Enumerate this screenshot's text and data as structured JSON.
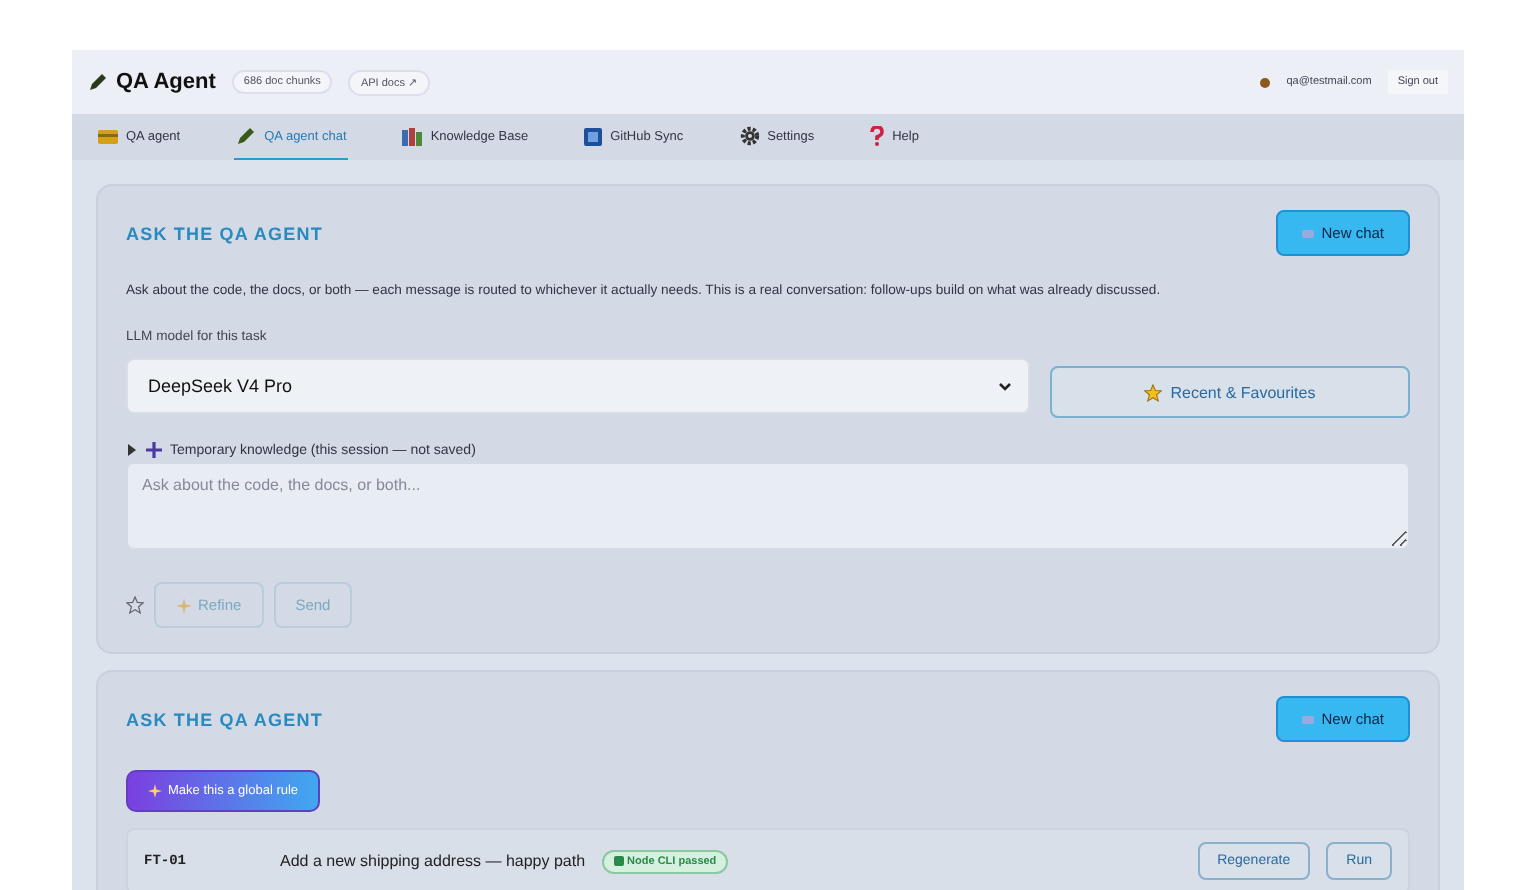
{
  "header": {
    "title": "QA Agent",
    "badges": [
      "686 doc chunks",
      "API docs ↗"
    ],
    "user": "qa@testmail.com",
    "sign_out": "Sign out"
  },
  "tabs": [
    {
      "label": "QA agent",
      "selected": false
    },
    {
      "label": "QA agent chat",
      "selected": true
    },
    {
      "label": "Knowledge Base",
      "selected": false
    },
    {
      "label": "GitHub Sync",
      "selected": false
    },
    {
      "label": "Settings",
      "selected": false
    },
    {
      "label": "Help",
      "selected": false
    }
  ],
  "chat_panel": {
    "title": "ASK THE QA AGENT",
    "new_chat": "New chat",
    "description": "Ask about the code, the docs, or both — each message is routed to whichever it actually needs. This is a real conversation: follow-ups build on what was already discussed.",
    "model_label": "LLM model for this task",
    "model": "DeepSeek V4 Pro",
    "recent": "Recent & Favourites",
    "temp_knowledge": {
      "label": "Temporary knowledge (this session — not saved)",
      "expanded": false
    },
    "placeholder": "Ask about the code, the docs, or both...",
    "favourite": false,
    "refine": {
      "label": "Refine",
      "disabled": true
    },
    "send": {
      "label": "Send",
      "disabled": true
    }
  },
  "second_panel": {
    "title": "ASK THE QA AGENT",
    "new_chat": "New chat",
    "global_rule": "Make this a global rule",
    "rows": [
      {
        "id": "FT-01",
        "title": "Add a new shipping address — happy path",
        "status": "Node CLI passed",
        "regenerate": "Regenerate",
        "run": "Run"
      }
    ]
  }
}
